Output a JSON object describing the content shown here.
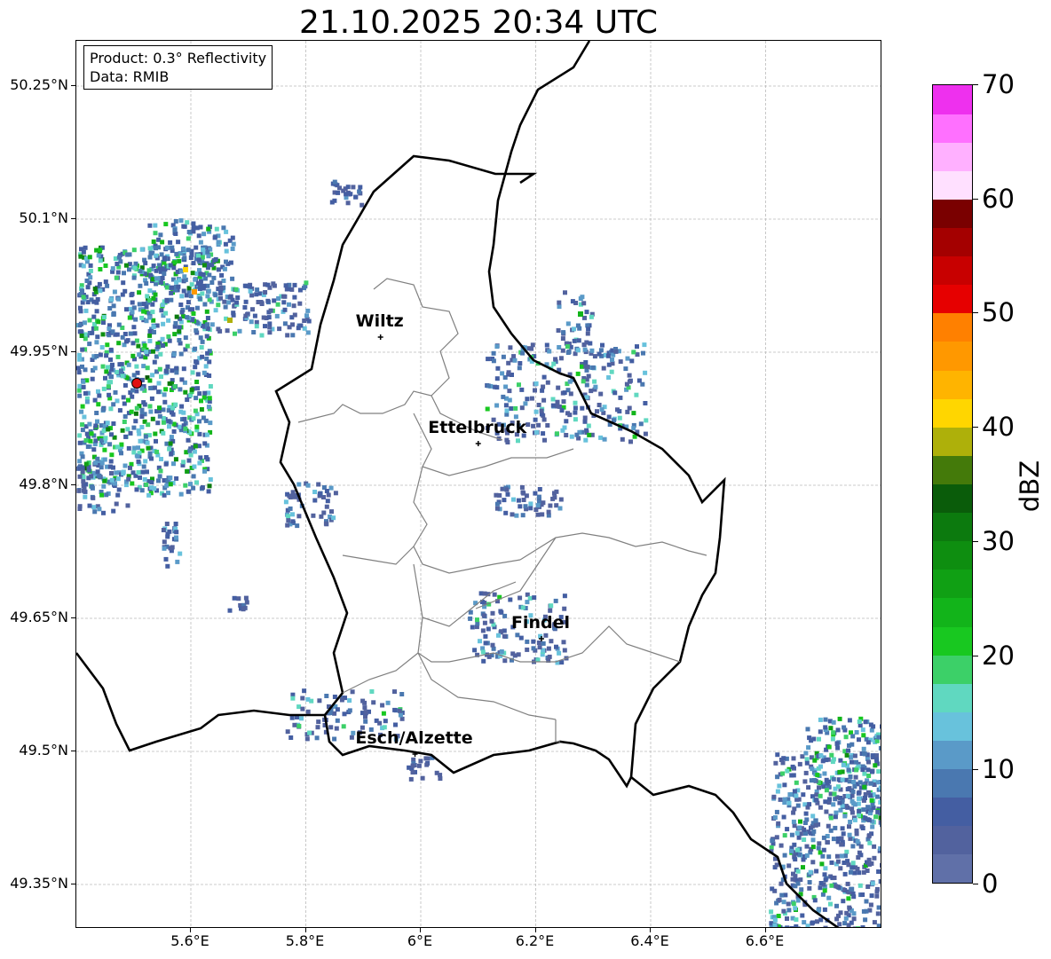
{
  "title": "21.10.2025 20:34 UTC",
  "info": {
    "product": "Product: 0.3° Reflectivity",
    "data": "Data: RMIB"
  },
  "axes": {
    "lon_range": [
      5.4,
      6.8
    ],
    "lat_range": [
      49.3,
      50.3
    ],
    "lon_ticks": [
      5.6,
      5.8,
      6.0,
      6.2,
      6.4,
      6.6
    ],
    "lon_labels": [
      "5.6°E",
      "5.8°E",
      "6°E",
      "6.2°E",
      "6.4°E",
      "6.6°E"
    ],
    "lat_ticks": [
      50.25,
      50.1,
      49.95,
      49.8,
      49.65,
      49.5,
      49.35
    ],
    "lat_labels": [
      "50.25°N",
      "50.1°N",
      "49.95°N",
      "49.8°N",
      "49.65°N",
      "49.5°N",
      "49.35°N"
    ],
    "grid": true
  },
  "colorbar": {
    "unit": "dBZ",
    "range": [
      0,
      70
    ],
    "labels": [
      "70",
      "60",
      "50",
      "40",
      "30",
      "20",
      "10",
      "0"
    ],
    "colors": [
      "#6070a8",
      "#52629e",
      "#445ea2",
      "#4a78b0",
      "#5a9ac8",
      "#68c2dc",
      "#60d8c0",
      "#3cd068",
      "#18c820",
      "#12b41a",
      "#10a014",
      "#0e8e10",
      "#0c7a0e",
      "#0a5c0a",
      "#447a0a",
      "#aeb00a",
      "#ffd600",
      "#ffb400",
      "#ff9800",
      "#ff8000",
      "#e60000",
      "#c80000",
      "#a40000",
      "#7a0000",
      "#ffe0ff",
      "#ffb0ff",
      "#ff70ff",
      "#ee30ee"
    ]
  },
  "cities": [
    {
      "name": "Wiltz",
      "lon": 5.93,
      "lat": 49.967
    },
    {
      "name": "Ettelbruck",
      "lon": 6.1,
      "lat": 49.847
    },
    {
      "name": "Findel",
      "lon": 6.21,
      "lat": 49.627
    },
    {
      "name": "Esch/Alzette",
      "lon": 5.99,
      "lat": 49.497
    }
  ],
  "radar_site": {
    "lon": 5.506,
    "lat": 49.915
  }
}
